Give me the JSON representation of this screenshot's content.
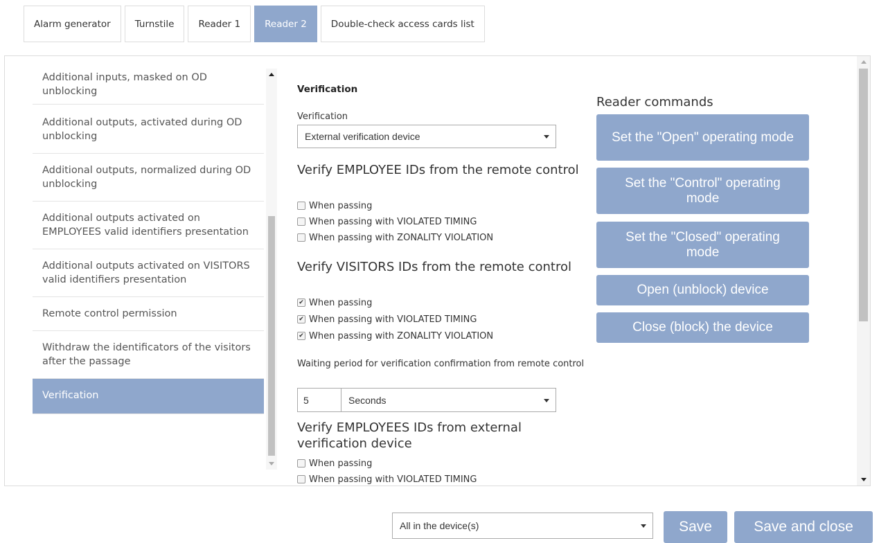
{
  "tabs": [
    {
      "label": "Alarm generator",
      "active": false
    },
    {
      "label": "Turnstile",
      "active": false
    },
    {
      "label": "Reader 1",
      "active": false
    },
    {
      "label": "Reader 2",
      "active": true
    },
    {
      "label": "Double-check access cards list",
      "active": false
    }
  ],
  "sidebar": {
    "items": [
      {
        "label": "Additional inputs, masked on OD unblocking",
        "active": false
      },
      {
        "label": "Additional outputs, activated during OD unblocking",
        "active": false
      },
      {
        "label": "Additional outputs, normalized during OD unblocking",
        "active": false
      },
      {
        "label": "Additional outputs activated on EMPLOYEES valid identifiers presentation",
        "active": false
      },
      {
        "label": "Additional outputs activated on VISITORS valid identifiers presentation",
        "active": false
      },
      {
        "label": "Remote control permission",
        "active": false
      },
      {
        "label": "Withdraw the identificators of the visitors after the passage",
        "active": false
      },
      {
        "label": "Verification",
        "active": true
      }
    ]
  },
  "form": {
    "section_title": "Verification",
    "verification_label": "Verification",
    "verification_value": "External verification device",
    "employee_remote": {
      "heading": "Verify EMPLOYEE IDs from the remote control",
      "options": [
        {
          "label": "When passing",
          "checked": false
        },
        {
          "label": "When passing with VIOLATED TIMING",
          "checked": false
        },
        {
          "label": "When passing with ZONALITY VIOLATION",
          "checked": false
        }
      ]
    },
    "visitor_remote": {
      "heading": "Verify VISITORS IDs from the remote control",
      "options": [
        {
          "label": "When passing",
          "checked": true
        },
        {
          "label": "When passing with VIOLATED TIMING",
          "checked": true
        },
        {
          "label": "When passing with ZONALITY VIOLATION",
          "checked": true
        }
      ]
    },
    "waiting_label": "Waiting period for verification confirmation from remote control",
    "waiting_value": "5",
    "waiting_unit": "Seconds",
    "employee_external": {
      "heading": "Verify EMPLOYEES IDs from external verification device",
      "options": [
        {
          "label": "When passing",
          "checked": false
        },
        {
          "label": "When passing with VIOLATED TIMING",
          "checked": false
        }
      ]
    }
  },
  "commands": {
    "title": "Reader commands",
    "buttons": [
      "Set the \"Open\" operating mode",
      "Set the \"Control\" operating mode",
      "Set the \"Closed\" operating mode",
      "Open (unblock) device",
      "Close (block) the device"
    ]
  },
  "footer": {
    "apply_scope": "All in the device(s)",
    "save_label": "Save",
    "save_close_label": "Save and close"
  },
  "colors": {
    "accent": "#8fa7cc",
    "border": "#dcdcdc"
  }
}
